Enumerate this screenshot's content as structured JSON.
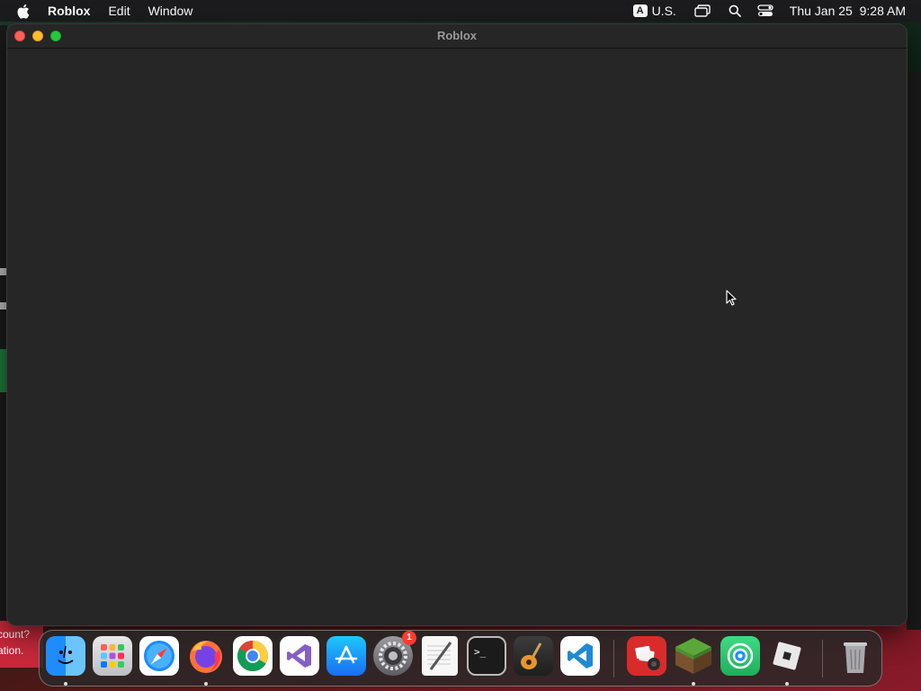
{
  "menubar": {
    "app_name": "Roblox",
    "menus": [
      "Edit",
      "Window"
    ],
    "input_source_badge": "A",
    "input_source_label": "U.S.",
    "datetime": "Thu Jan 25  9:28 AM"
  },
  "window": {
    "title": "Roblox"
  },
  "background": {
    "banner_line1": "count?",
    "banner_line2": "ation."
  },
  "dock": {
    "items": [
      {
        "name": "Finder",
        "icon": "finder-icon",
        "running": true
      },
      {
        "name": "Launchpad",
        "icon": "launchpad-icon",
        "running": false
      },
      {
        "name": "Safari",
        "icon": "safari-icon",
        "running": false
      },
      {
        "name": "Firefox",
        "icon": "firefox-icon",
        "running": true
      },
      {
        "name": "Google Chrome",
        "icon": "chrome-icon",
        "running": false
      },
      {
        "name": "Visual Studio",
        "icon": "visual-studio-icon",
        "running": false
      },
      {
        "name": "App Store",
        "icon": "app-store-icon",
        "running": false
      },
      {
        "name": "System Settings",
        "icon": "system-settings-icon",
        "running": false,
        "badge": "1"
      },
      {
        "name": "TextEdit",
        "icon": "textedit-icon",
        "running": false
      },
      {
        "name": "Terminal",
        "icon": "terminal-icon",
        "running": false
      },
      {
        "name": "GarageBand",
        "icon": "garageband-icon",
        "running": false
      },
      {
        "name": "Visual Studio Code",
        "icon": "vscode-icon",
        "running": false
      },
      {
        "name": "Photo Booth",
        "icon": "photo-booth-icon",
        "running": false
      },
      {
        "name": "Minecraft",
        "icon": "minecraft-icon",
        "running": true
      },
      {
        "name": "Find My",
        "icon": "find-my-icon",
        "running": false
      },
      {
        "name": "Roblox",
        "icon": "roblox-icon",
        "running": true
      },
      {
        "name": "Trash",
        "icon": "trash-icon",
        "running": false
      }
    ]
  },
  "colors": {
    "menubar_bg": "#1c1c1e",
    "window_bg": "#262626",
    "close": "#ff5f57",
    "minimize": "#febc2e",
    "maximize": "#28c840",
    "badge": "#ff3b30"
  }
}
